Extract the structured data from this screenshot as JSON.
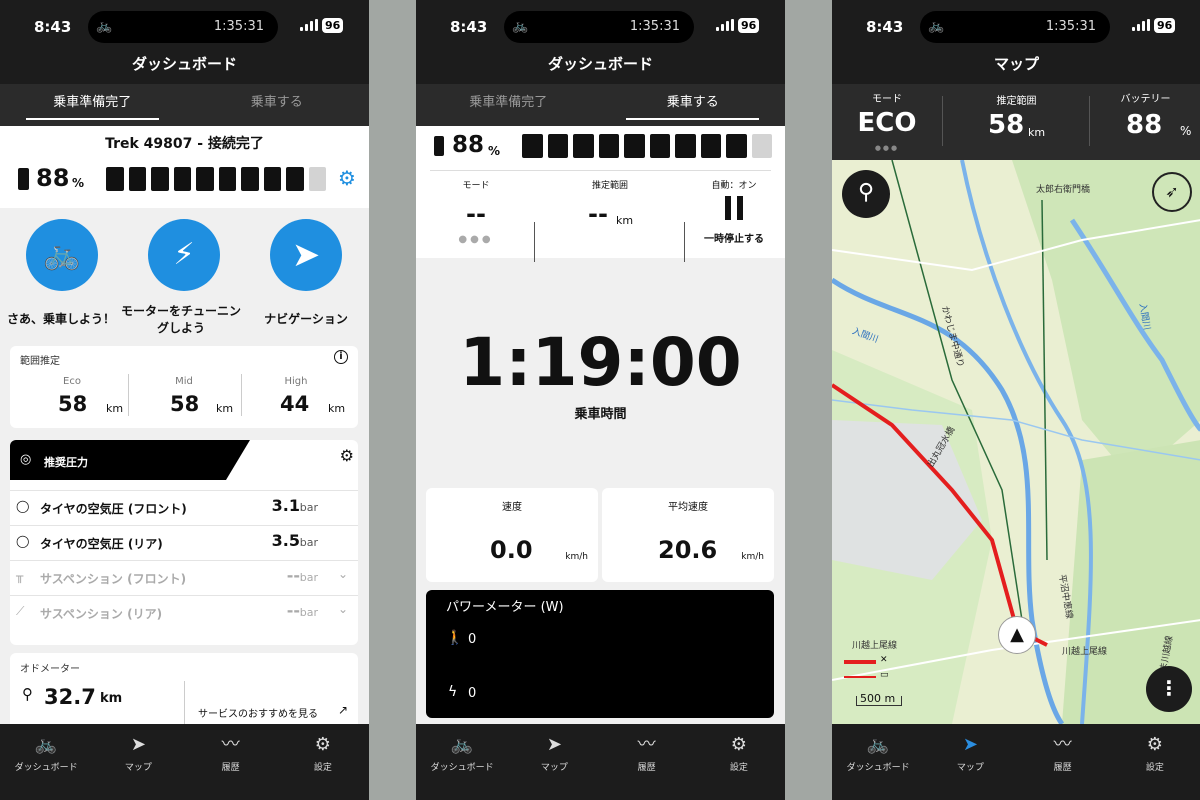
{
  "status_bar": {
    "time": "8:43",
    "island_time": "1:35:31",
    "battery": "96"
  },
  "nav": {
    "dashboard": "ダッシュボード",
    "map": "マップ",
    "history": "履歴",
    "settings": "設定"
  },
  "screen1": {
    "title": "ダッシュボード",
    "tabs": [
      "乗車準備完了",
      "乗車する"
    ],
    "bike_name": "Trek 49807 - 接続完了",
    "battery_value": "88",
    "battery_unit": "%",
    "battery_level_fraction": 0.9,
    "actions": {
      "ride": "さあ、乗車しよう！",
      "tune": "モーターをチューニングしよう",
      "navigate": "ナビゲーション"
    },
    "range": {
      "title": "範囲推定",
      "items": [
        {
          "mode": "Eco",
          "value": "58",
          "unit": "km"
        },
        {
          "mode": "Mid",
          "value": "58",
          "unit": "km"
        },
        {
          "mode": "High",
          "value": "44",
          "unit": "km"
        }
      ]
    },
    "pressure": {
      "title": "推奨圧力",
      "rows": [
        {
          "name": "タイヤの空気圧 (フロント)",
          "value": "3.1",
          "unit": "bar"
        },
        {
          "name": "タイヤの空気圧 (リア)",
          "value": "3.5",
          "unit": "bar"
        },
        {
          "name": "サスペンション (フロント)",
          "value": "--",
          "unit": "bar"
        },
        {
          "name": "サスペンション (リア)",
          "value": "--",
          "unit": "bar"
        }
      ]
    },
    "odometer": {
      "title": "オドメーター",
      "value": "32.7",
      "unit": "km",
      "service_link": "サービスのおすすめを見る"
    }
  },
  "screen2": {
    "title": "ダッシュボード",
    "tabs": [
      "乗車準備完了",
      "乗車する"
    ],
    "battery_value": "88",
    "battery_unit": "%",
    "battery_level_fraction": 0.9,
    "mode_label": "モード",
    "mode_value": "--",
    "range_label": "推定範囲",
    "range_value": "--",
    "range_unit": "km",
    "auto_label": "自動：オン",
    "pause_label": "一時停止する",
    "ride_time": "1:19:00",
    "ride_time_label": "乗車時間",
    "speed_label": "速度",
    "speed_value": "0.0",
    "speed_unit": "km/h",
    "avg_speed_label": "平均速度",
    "avg_speed_value": "20.6",
    "avg_speed_unit": "km/h",
    "power_title": "パワーメーター (W)",
    "rider_power": "0",
    "motor_power": "0"
  },
  "screen3": {
    "title": "マップ",
    "mode_label": "モード",
    "mode_value": "ECO",
    "range_label": "推定範囲",
    "range_value": "58",
    "range_unit": "km",
    "battery_label": "バッテリー",
    "battery_value": "88",
    "battery_unit": "%",
    "scale_label": "500 m",
    "map_labels": [
      "太郎右衛門橋",
      "出丸冠水橋",
      "平沼中恵線",
      "川越上尾線",
      "川越上尾線",
      "さいたま川越線",
      "かわじま中通り",
      "入間川",
      "入間川"
    ]
  },
  "colors": {
    "accent": "#1f8fe0",
    "route": "#e41e1e",
    "dark": "#1c1c1c"
  }
}
